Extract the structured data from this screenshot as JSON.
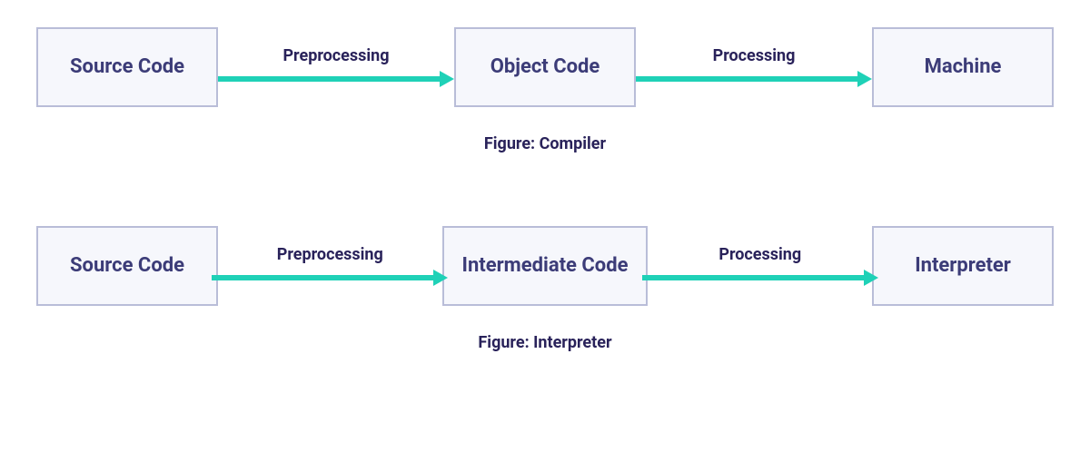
{
  "colors": {
    "arrow": "#1fd1b7",
    "box_bg": "#f6f7fc",
    "box_border": "#b9bdd8",
    "text_box": "#3c3c78",
    "text_caption": "#29225a"
  },
  "flows": [
    {
      "nodes": [
        {
          "id": "source-code",
          "label": "Source Code"
        },
        {
          "id": "object-code",
          "label": "Object Code"
        },
        {
          "id": "machine",
          "label": "Machine"
        }
      ],
      "edges": [
        {
          "from": "source-code",
          "to": "object-code",
          "label": "Preprocessing"
        },
        {
          "from": "object-code",
          "to": "machine",
          "label": "Processing"
        }
      ],
      "caption": "Figure: Compiler"
    },
    {
      "nodes": [
        {
          "id": "source-code-2",
          "label": "Source Code"
        },
        {
          "id": "intermediate-code",
          "label": "Intermediate Code"
        },
        {
          "id": "interpreter",
          "label": "Interpreter"
        }
      ],
      "edges": [
        {
          "from": "source-code-2",
          "to": "intermediate-code",
          "label": "Preprocessing"
        },
        {
          "from": "intermediate-code",
          "to": "interpreter",
          "label": "Processing"
        }
      ],
      "caption": "Figure: Interpreter"
    }
  ]
}
